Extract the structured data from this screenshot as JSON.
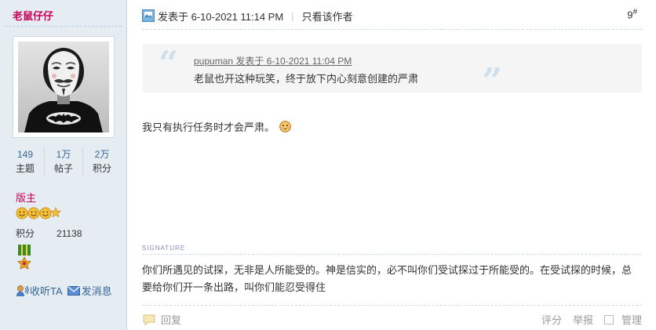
{
  "author": {
    "username": "老鼠仔仔",
    "stats": [
      {
        "value": "149",
        "label": "主题"
      },
      {
        "value": "1万",
        "label": "帖子"
      },
      {
        "value": "2万",
        "label": "积分"
      }
    ],
    "group": "版主",
    "credit_label": "积分",
    "credit_value": "21138",
    "listen_label": "收听TA",
    "message_label": "发消息"
  },
  "post": {
    "posted_label": "发表于 6-10-2021 11:14 PM",
    "only_author_label": "只看该作者",
    "floor_number": "9",
    "floor_suffix": "#",
    "quote": {
      "meta": "pupuman 发表于 6-10-2021 11:04 PM",
      "text": "老鼠也开这种玩笑，终于放下内心刻意创建的严肃"
    },
    "message": "我只有执行任务时才会严肃。",
    "signature_label": "SIGNATURE",
    "signature_text": "你们所遇见的试探，无非是人所能受的。神是信实的，必不叫你们受试探过于所能受的。在受试探的时候，总要给你们开一条出路，叫你们能忍受得住"
  },
  "footer": {
    "reply_label": "回复",
    "rate_label": "评分",
    "report_label": "举报",
    "manage_label": "管理"
  },
  "icons": {
    "post_icon": "post-icon",
    "listen_icon": "listen-icon",
    "message_icon": "envelope-icon",
    "reply_icon": "reply-bubble-icon",
    "emoticon": "smiley-icon",
    "medal": "medal-icon"
  },
  "colors": {
    "username": "#c8005a",
    "link": "#336699",
    "sidebar_bg": "#e5edf2",
    "quote_bg": "#f5f5f5"
  }
}
